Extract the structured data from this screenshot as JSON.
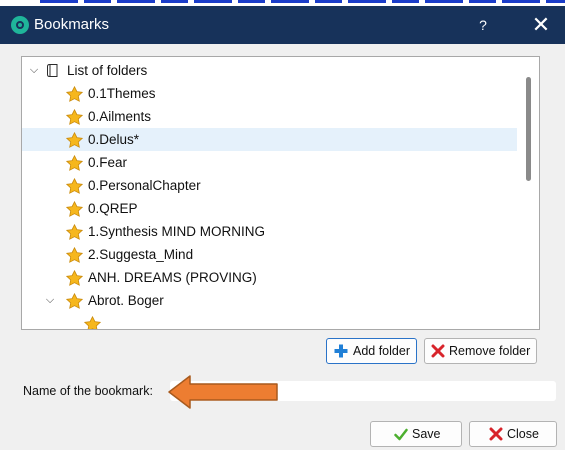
{
  "window": {
    "title": "Bookmarks",
    "help_glyph": "?",
    "close_glyph": "✕"
  },
  "tree": {
    "root": {
      "label": "List of folders",
      "icon": "book-icon",
      "expanded": true
    },
    "items": [
      {
        "label": "0.1Themes",
        "icon": "star-icon",
        "selected": false
      },
      {
        "label": "0.Ailments",
        "icon": "star-icon",
        "selected": false
      },
      {
        "label": "0.Delus*",
        "icon": "star-icon",
        "selected": true
      },
      {
        "label": "0.Fear",
        "icon": "star-icon",
        "selected": false
      },
      {
        "label": "0.PersonalChapter",
        "icon": "star-icon",
        "selected": false
      },
      {
        "label": "0.QREP",
        "icon": "star-icon",
        "selected": false
      },
      {
        "label": "1.Synthesis MIND MORNING",
        "icon": "star-icon",
        "selected": false
      },
      {
        "label": "2.Suggesta_Mind",
        "icon": "star-icon",
        "selected": false
      },
      {
        "label": "ANH. DREAMS (PROVING)",
        "icon": "star-icon",
        "selected": false
      },
      {
        "label": "Abrot. Boger",
        "icon": "star-icon",
        "selected": false,
        "expanded": true
      }
    ]
  },
  "buttons": {
    "add_folder": "Add folder",
    "remove_folder": "Remove folder",
    "save": "Save",
    "close": "Close"
  },
  "bookmark_name": {
    "label": "Name of the bookmark:",
    "value": ""
  },
  "annotation": {
    "icon": "arrow-left-icon",
    "color": "#ed7d31",
    "outline_color": "#a85a1e"
  },
  "colors": {
    "titlebar": "#17325a",
    "selection": "#e5f1fb",
    "app_icon": "#1fb59a",
    "star": "#f6b71d",
    "add_icon": "#1f7fd6",
    "remove_icon": "#d8232a",
    "save_icon": "#4caf2f"
  }
}
